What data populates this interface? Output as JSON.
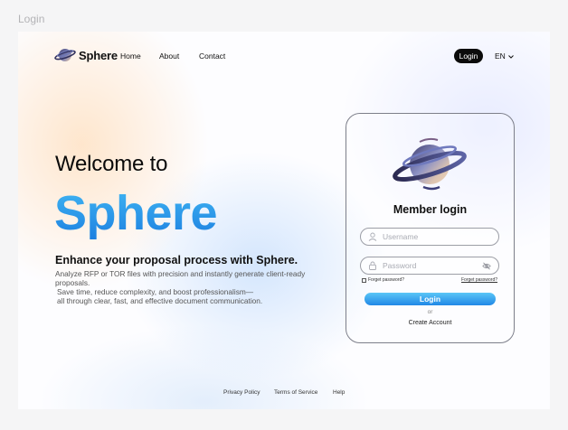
{
  "frame_label": "Login",
  "nav": {
    "brand": "Sphere",
    "links": [
      "Home",
      "About",
      "Contact"
    ],
    "login": "Login",
    "language": "EN"
  },
  "hero": {
    "welcome": "Welcome to",
    "brand": "Sphere",
    "tagline": "Enhance your proposal process with Sphere.",
    "desc_line1": "Analyze RFP or TOR files with precision and instantly generate client-ready proposals.",
    "desc_line2": "Save time, reduce complexity, and boost professionalism—",
    "desc_line3": "all through clear, fast, and effective document communication."
  },
  "login_card": {
    "title": "Member login",
    "username_placeholder": "Username",
    "password_placeholder": "Password",
    "remember_label": "Forget password?",
    "forgot_label": "Forget password?",
    "login_button": "Login",
    "or": "or",
    "create_account": "Create Account"
  },
  "footer": {
    "privacy": "Privacy Policy",
    "terms": "Terms of Service",
    "help": "Help"
  },
  "colors": {
    "accent_gradient_top": "#5ac6f7",
    "accent_gradient_bottom": "#2188e6",
    "brand_text_top": "#41b6f3",
    "brand_text_bottom": "#1c7fe0",
    "dark": "#0b0b0b"
  },
  "icons": [
    "sphere-logo-icon",
    "chevron-down-icon",
    "user-icon",
    "lock-icon",
    "eye-off-icon",
    "sphere-emblem-icon"
  ]
}
